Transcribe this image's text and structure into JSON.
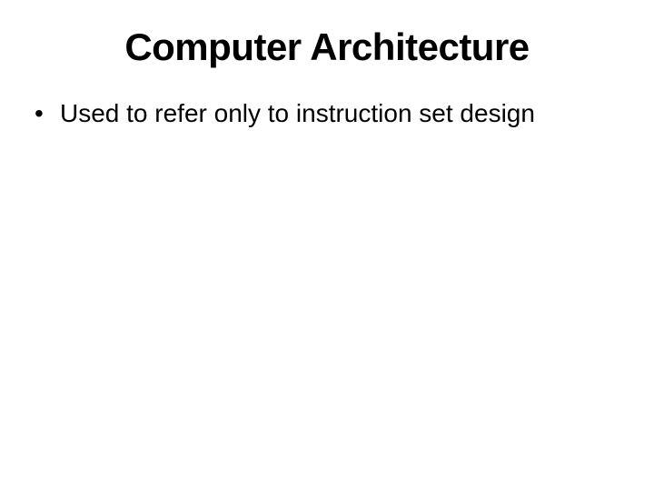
{
  "slide": {
    "title": "Computer Architecture",
    "bullets": [
      "Used to refer only to instruction set design"
    ]
  }
}
